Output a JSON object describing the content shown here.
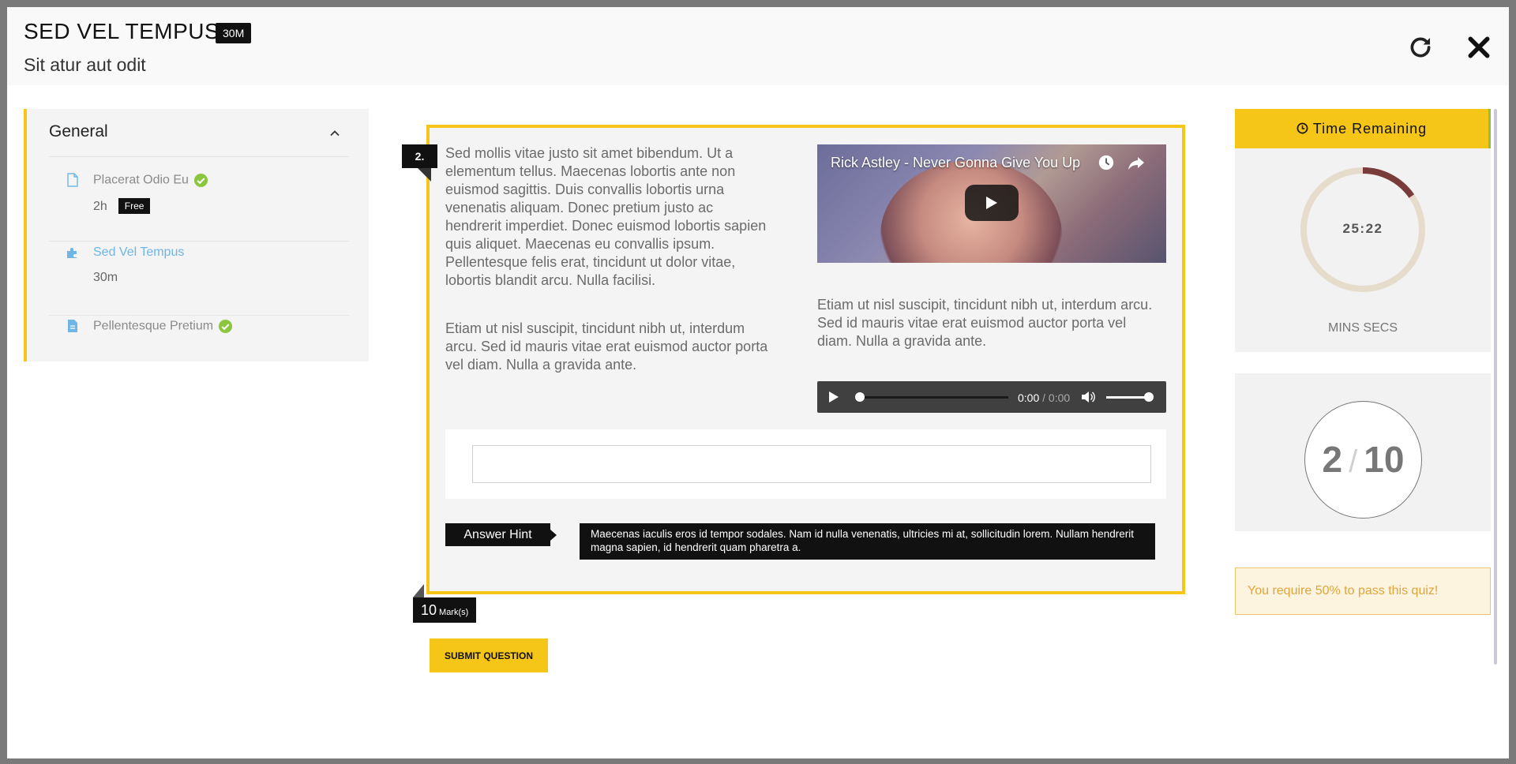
{
  "header": {
    "title": "SED VEL TEMPUS",
    "duration_badge": "30M",
    "subtitle": "Sit atur aut odit"
  },
  "sidebar": {
    "section_title": "General",
    "items": [
      {
        "name": "Placerat Odio Eu",
        "duration": "2h",
        "badge": "Free",
        "completed": true,
        "icon": "file-icon",
        "active": false
      },
      {
        "name": "Sed Vel Tempus",
        "duration": "30m",
        "completed": false,
        "icon": "puzzle-icon",
        "active": true
      },
      {
        "name": "Pellentesque Pretium",
        "completed": true,
        "icon": "document-icon",
        "active": false
      }
    ]
  },
  "question": {
    "number": "2.",
    "paragraphs": [
      "Sed mollis vitae justo sit amet bibendum. Ut a elementum tellus. Maecenas lobortis ante non euismod sagittis. Duis convallis lobortis urna venenatis aliquam. Donec pretium justo ac hendrerit imperdiet. Donec euismod lobortis sapien quis aliquet. Maecenas eu convallis ipsum. Pellentesque felis erat, tincidunt ut dolor vitae, lobortis blandit arcu. Nulla facilisi.",
      "Etiam ut nisl suscipit, tincidunt nibh ut, interdum arcu. Sed id mauris vitae erat euismod auctor porta vel diam. Nulla a gravida ante."
    ],
    "video_title": "Rick Astley - Never Gonna Give You Up",
    "side_text": "Etiam ut nisl suscipit, tincidunt nibh ut, interdum arcu. Sed id mauris vitae erat euismod auctor porta vel diam. Nulla a gravida ante.",
    "audio": {
      "current": "0:00",
      "separator": " / ",
      "total": "0:00"
    },
    "answer_value": "",
    "answer_hint_label": "Answer Hint",
    "answer_hint_text": "Maecenas iaculis eros id tempor sodales. Nam id nulla venenatis, ultricies mi at, sollicitudin lorem. Nullam hendrerit magna sapien, id hendrerit quam pharetra a.",
    "marks": "10",
    "marks_label": "Mark(s)",
    "submit_label": "SUBMIT QUESTION"
  },
  "timer": {
    "title": "Time Remaining",
    "value": "25:22",
    "units": "MINS SECS",
    "elapsed_fraction": 0.154
  },
  "progress": {
    "current": "2",
    "separator": "/",
    "total": "10"
  },
  "pass_note": "You require 50% to pass this quiz!",
  "colors": {
    "accent": "#f5c518",
    "active_link": "#6fb6e6",
    "check_green": "#8cc63f",
    "timer_elapsed": "#7a3b3b",
    "timer_remaining": "#e6dccb",
    "pass_text": "#e0a43a"
  }
}
